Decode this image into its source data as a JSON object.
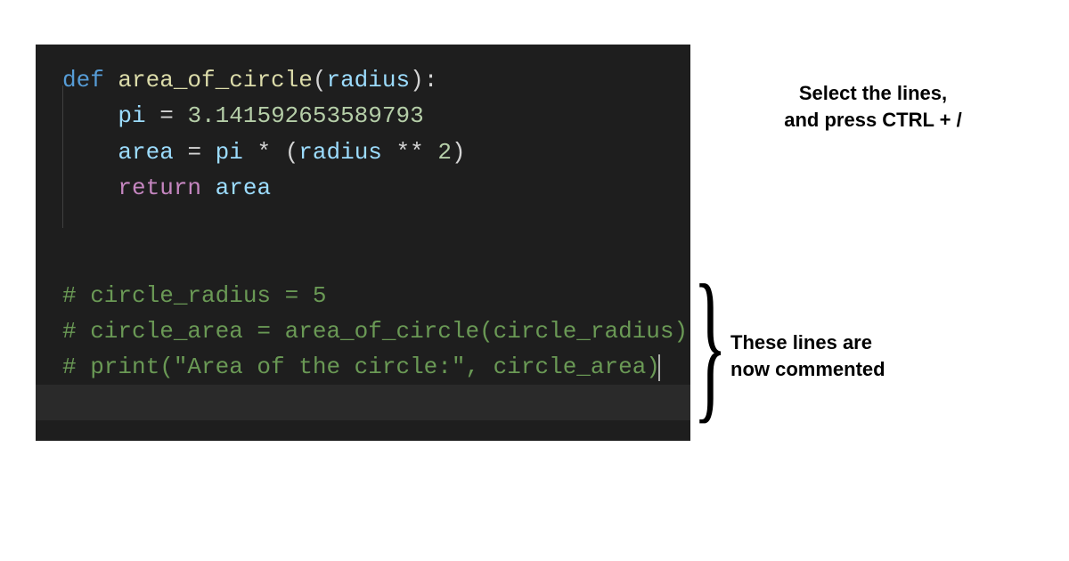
{
  "code": {
    "l1": {
      "def": "def",
      "fn": "area_of_circle",
      "lp": "(",
      "param": "radius",
      "rp": "):"
    },
    "l2": {
      "indent": "    ",
      "var": "pi",
      "eq": " = ",
      "val": "3.141592653589793"
    },
    "l3": {
      "indent": "    ",
      "var": "area",
      "eq": " = ",
      "pi": "pi",
      "mul": " * ",
      "lp": "(",
      "rad": "radius",
      "pow": " ** ",
      "two": "2",
      "rp": ")"
    },
    "l4": {
      "indent": "    ",
      "ret": "return",
      "sp": " ",
      "var": "area"
    },
    "l7": {
      "text": "# circle_radius = 5"
    },
    "l8": {
      "text": "# circle_area = area_of_circle(circle_radius)"
    },
    "l9": {
      "text": "# print(\"Area of the circle:\", circle_area)"
    }
  },
  "annotations": {
    "top_line1": "Select the lines,",
    "top_line2": "and press CTRL + /",
    "bottom_line1": "These lines are",
    "bottom_line2": "now commented"
  }
}
